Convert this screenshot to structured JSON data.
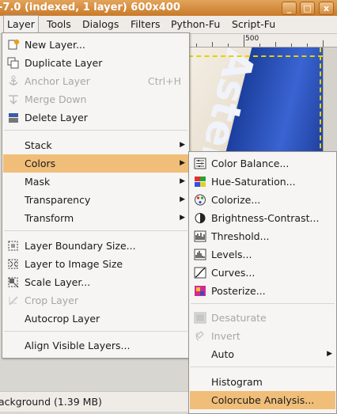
{
  "window": {
    "title": "-7.0 (indexed, 1 layer) 600x400",
    "buttons": [
      "_",
      "□",
      "x"
    ]
  },
  "menubar": [
    "Layer",
    "Tools",
    "Dialogs",
    "Filters",
    "Python-Fu",
    "Script-Fu"
  ],
  "ruler": {
    "mark": "500"
  },
  "canvas": {
    "sign_text": "Aster"
  },
  "status": {
    "text": "ackground (1.39 MB)"
  },
  "layer_menu": [
    {
      "label": "New Layer...",
      "icon": "new-layer-icon"
    },
    {
      "label": "Duplicate Layer",
      "icon": "duplicate-layer-icon"
    },
    {
      "label": "Anchor Layer",
      "shortcut": "Ctrl+H",
      "icon": "anchor-icon",
      "disabled": true
    },
    {
      "label": "Merge Down",
      "icon": "merge-down-icon",
      "disabled": true
    },
    {
      "label": "Delete Layer",
      "icon": "delete-layer-icon"
    },
    {
      "label": "Stack",
      "submenu": true
    },
    {
      "label": "Colors",
      "submenu": true,
      "highlighted": true
    },
    {
      "label": "Mask",
      "submenu": true
    },
    {
      "label": "Transparency",
      "submenu": true
    },
    {
      "label": "Transform",
      "submenu": true
    },
    {
      "label": "Layer Boundary Size...",
      "icon": "layer-boundary-icon"
    },
    {
      "label": "Layer to Image Size",
      "icon": "layer-to-image-icon"
    },
    {
      "label": "Scale Layer...",
      "icon": "scale-layer-icon"
    },
    {
      "label": "Crop Layer",
      "icon": "crop-icon",
      "disabled": true
    },
    {
      "label": "Autocrop Layer"
    },
    {
      "label": "Align Visible Layers..."
    }
  ],
  "colors_menu": [
    {
      "label": "Color Balance...",
      "icon": "color-balance-icon"
    },
    {
      "label": "Hue-Saturation...",
      "icon": "hue-saturation-icon"
    },
    {
      "label": "Colorize...",
      "icon": "colorize-icon"
    },
    {
      "label": "Brightness-Contrast...",
      "icon": "brightness-contrast-icon"
    },
    {
      "label": "Threshold...",
      "icon": "threshold-icon"
    },
    {
      "label": "Levels...",
      "icon": "levels-icon"
    },
    {
      "label": "Curves...",
      "icon": "curves-icon"
    },
    {
      "label": "Posterize...",
      "icon": "posterize-icon"
    },
    {
      "label": "Desaturate",
      "icon": "desaturate-icon",
      "disabled": true
    },
    {
      "label": "Invert",
      "icon": "invert-icon",
      "disabled": true
    },
    {
      "label": "Auto",
      "submenu": true
    },
    {
      "label": "Histogram"
    },
    {
      "label": "Colorcube Analysis...",
      "highlighted": true
    }
  ]
}
